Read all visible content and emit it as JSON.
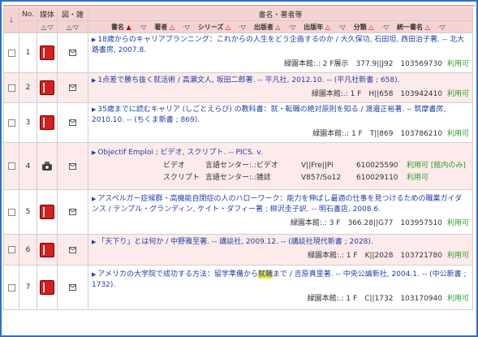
{
  "header": {
    "no": "No.",
    "media": "媒体",
    "figure": "図・雑",
    "title_author": "書名・著者等",
    "sort_cols": [
      "書名",
      "著者",
      "シリーズ",
      "出版者",
      "出版年",
      "分類",
      "統一書名"
    ]
  },
  "rows": [
    {
      "no": "1",
      "media": "book-icon",
      "title": "18歳からのキャリアプランニング：これからの人生をどう企画するのか / 大久保功, 石田坦, 西田治子著. -- 北大路書房, 2007.8.",
      "holding": "緑園本館:.: 2 F展示　377.9||J92　103569730",
      "status": "利用可"
    },
    {
      "no": "2",
      "media": "book-icon",
      "title": "1点差で勝ち抜く就活術 / 高瀬文人, 坂田二郎著. -- 平凡社, 2012.10. -- (平凡社新書 ; 658).",
      "holding": "緑園本館:.: 1 F　H||658　103942410",
      "status": "利用可"
    },
    {
      "no": "3",
      "media": "book-icon",
      "title": "35歳までに読むキャリア (しごとえらび) の教科書：就・転職の絶対原則を知る / 渡邉正裕著. -- 筑摩書房, 2010.10. -- (ちくま新書 ; 869).",
      "holding": "緑園本館:.: 1 F　T||869　103786210",
      "status": "利用可"
    },
    {
      "no": "4",
      "media": "camera-icon",
      "title": "Objectif Emploi ; ビデオ, スクリプト. -- PICS. v.",
      "sub": [
        {
          "kind": "ビデオ",
          "site": "言語センター:.:ビデオ",
          "call": "V||Fre||Pi",
          "id": "610025590",
          "status": "利用可 [館内のみ]"
        },
        {
          "kind": "スクリプト",
          "site": "言語センター:.:雑誌",
          "call": "V857/So12",
          "id": "610029110",
          "status": "利用可"
        }
      ]
    },
    {
      "no": "5",
      "media": "book-icon",
      "title": "アスペルガー症候群・高機能自閉症の人のハローワーク：能力を伸ばし最適の仕事を見つけるための職業ガイダンス / テンプル・グランディン, ケイト・ダフィー著 ; 柳沢圭子訳. -- 明石書店, 2008.6.",
      "holding": "緑園本館:.: 3 F　366.28||G77　103957510",
      "status": "利用可"
    },
    {
      "no": "6",
      "media": "book-icon",
      "title": "「天下り」とは何か / 中野雅至著. -- 講談社, 2009.12. -- (講談社現代新書 ; 2028).",
      "holding": "緑園本館:.: 1 F　K||2028　103721780",
      "status": "利用可"
    },
    {
      "no": "7",
      "media": "book-icon",
      "title_pre": "アメリカの大学院で成功する方法：留学準備から",
      "title_hl": "就職",
      "title_post": "まで / 吉原真里著. -- 中央公論新社, 2004.1. -- (中公新書 ; 1732).",
      "holding": "緑園本館:.: 1 F　C||1732　103170940",
      "status": "利用可"
    }
  ]
}
